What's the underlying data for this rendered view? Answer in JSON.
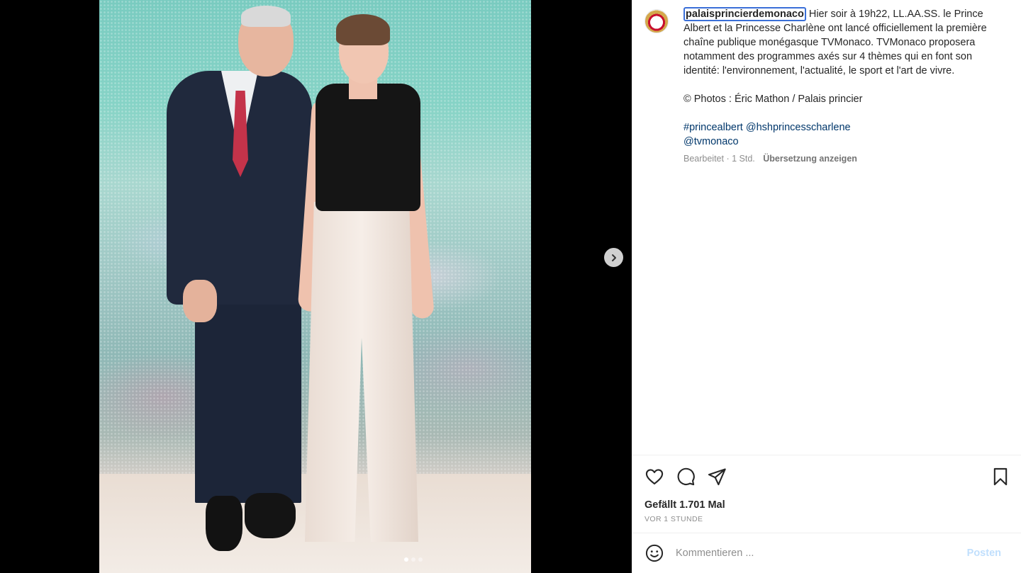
{
  "post": {
    "username": "palaisprincierdemonaco",
    "caption_lines": [
      "Hier soir à 19h22, LL.AA.SS. le Prince Albert et la Princesse Charlène ont lancé officiellement la première chaîne publique monégasque TVMonaco. TVMonaco proposera notamment des programmes axés sur 4 thèmes qui en font son identité: l'environnement, l'actualité, le sport et l'art de vivre.",
      "© Photos : Éric Mathon / Palais princier"
    ],
    "hashtag": "#princealbert",
    "mention_1": "@hshprincesscharlene",
    "mention_2": "@tvmonaco",
    "edited_label": "Bearbeitet · 1 Std.",
    "translate_label": "Übersetzung anzeigen",
    "likes_label": "Gefällt 1.701 Mal",
    "time_label": "VOR 1 STUNDE"
  },
  "comment": {
    "placeholder": "Kommentieren ...",
    "post_label": "Posten"
  },
  "carousel": {
    "total_slides": 3,
    "active_slide": 1
  },
  "icons": {
    "like": "heart-icon",
    "comment": "comment-icon",
    "share": "send-icon",
    "save": "bookmark-icon",
    "emoji": "emoji-icon",
    "next": "chevron-right-icon"
  },
  "colors": {
    "link": "#00376b",
    "post_button_disabled": "#c0dffd",
    "focus_outline": "#3a6fd8"
  }
}
